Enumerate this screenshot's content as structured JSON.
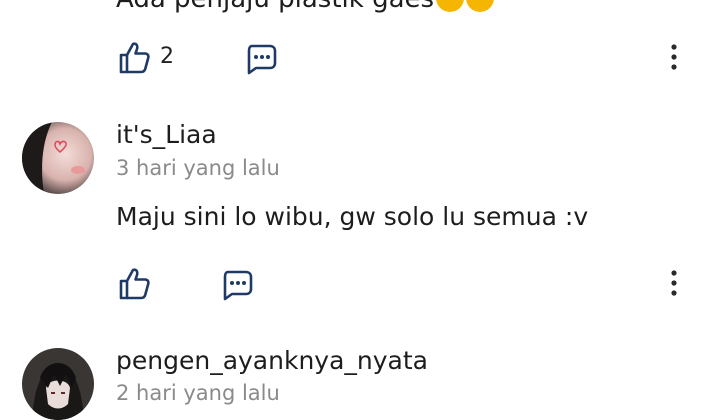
{
  "comment_above": {
    "text": "Ada penjaju plastik gaes",
    "like_count": "2"
  },
  "comments": [
    {
      "username": "it's_Liaa",
      "time": "3 hari yang lalu",
      "text": "Maju sini lo wibu, gw solo lu semua :v",
      "like_count": ""
    },
    {
      "username": "pengen_ayanknya_nyata",
      "time": "2 hari yang lalu"
    }
  ],
  "colors": {
    "icon_blue": "#1f3a66",
    "text": "#1d1d1d",
    "muted": "#8a8a8a",
    "emoji": "#f5b500"
  }
}
